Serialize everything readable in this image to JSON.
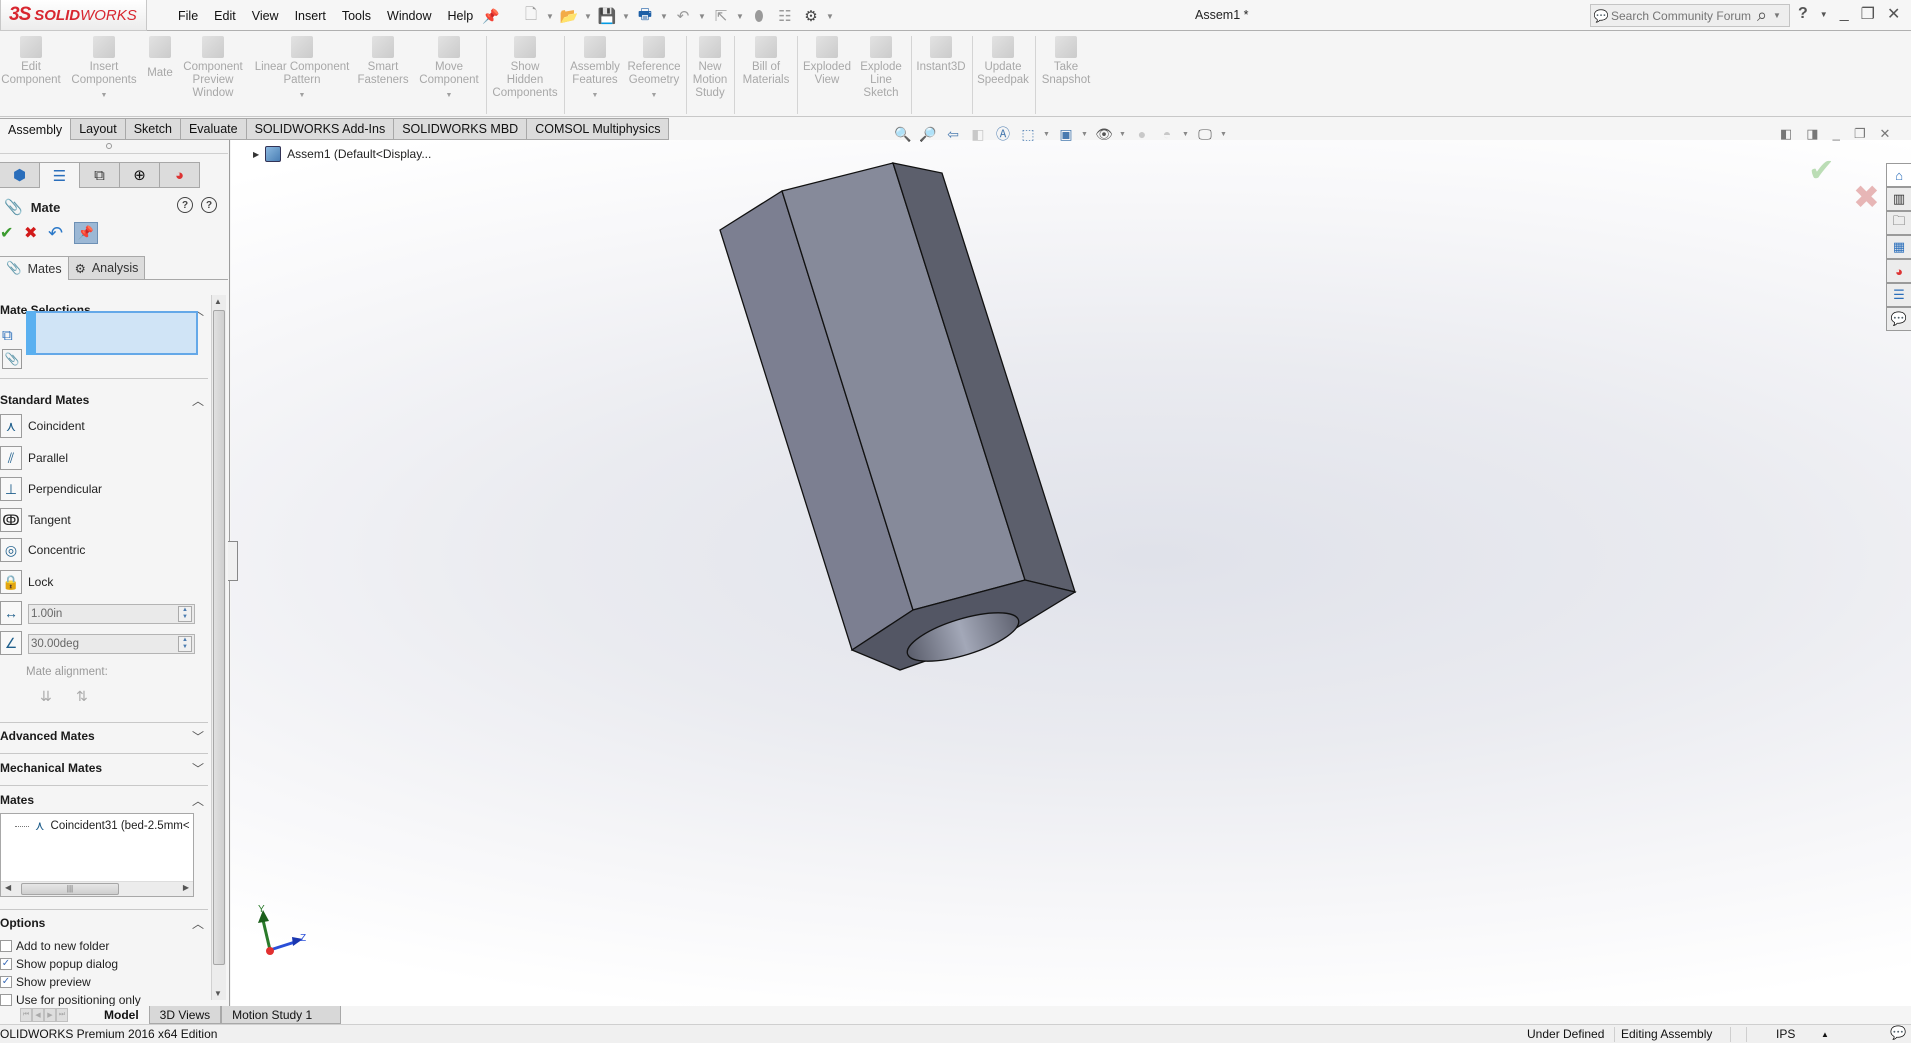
{
  "app": {
    "logo_mark": "3S",
    "logo_bold": "SOLID",
    "logo_light": "WORKS",
    "document_title": "Assem1 *"
  },
  "menubar": {
    "items": [
      "File",
      "Edit",
      "View",
      "Insert",
      "Tools",
      "Window",
      "Help"
    ]
  },
  "quick_access": {
    "icons": [
      "new-document-icon",
      "open-icon",
      "save-icon",
      "print-icon",
      "undo-icon",
      "select-icon",
      "rebuild-icon",
      "file-properties-icon",
      "options-gear-icon"
    ]
  },
  "search": {
    "placeholder": "Search Community Forum"
  },
  "window_controls": {
    "help": "?",
    "minimize": "_",
    "restore": "❐",
    "close": "✕"
  },
  "command_manager": {
    "commands": [
      {
        "label1": "Edit",
        "label2": "Component",
        "label3": "",
        "dropdown": false
      },
      {
        "label1": "Insert",
        "label2": "Components",
        "label3": "",
        "dropdown": true
      },
      {
        "label1": "Mate",
        "label2": "",
        "label3": "",
        "dropdown": false
      },
      {
        "label1": "Component",
        "label2": "Preview",
        "label3": "Window",
        "dropdown": false
      },
      {
        "label1": "Linear Component",
        "label2": "Pattern",
        "label3": "",
        "dropdown": true
      },
      {
        "label1": "Smart",
        "label2": "Fasteners",
        "label3": "",
        "dropdown": false
      },
      {
        "label1": "Move",
        "label2": "Component",
        "label3": "",
        "dropdown": true
      },
      {
        "label1": "Show",
        "label2": "Hidden",
        "label3": "Components",
        "dropdown": false
      },
      {
        "label1": "Assembly",
        "label2": "Features",
        "label3": "",
        "dropdown": true
      },
      {
        "label1": "Reference",
        "label2": "Geometry",
        "label3": "",
        "dropdown": true
      },
      {
        "label1": "New",
        "label2": "Motion",
        "label3": "Study",
        "dropdown": false
      },
      {
        "label1": "Bill of",
        "label2": "Materials",
        "label3": "",
        "dropdown": false
      },
      {
        "label1": "Exploded",
        "label2": "View",
        "label3": "",
        "dropdown": false
      },
      {
        "label1": "Explode",
        "label2": "Line",
        "label3": "Sketch",
        "dropdown": false
      },
      {
        "label1": "Instant3D",
        "label2": "",
        "label3": "",
        "dropdown": false
      },
      {
        "label1": "Update",
        "label2": "Speedpak",
        "label3": "",
        "dropdown": false
      },
      {
        "label1": "Take",
        "label2": "Snapshot",
        "label3": "",
        "dropdown": false
      }
    ]
  },
  "tabs": [
    {
      "label": "Assembly",
      "active": true
    },
    {
      "label": "Layout",
      "active": false
    },
    {
      "label": "Sketch",
      "active": false
    },
    {
      "label": "Evaluate",
      "active": false
    },
    {
      "label": "SOLIDWORKS Add-Ins",
      "active": false
    },
    {
      "label": "SOLIDWORKS MBD",
      "active": false
    },
    {
      "label": "COMSOL Multiphysics",
      "active": false
    }
  ],
  "feature_tree": {
    "root_label": "Assem1  (Default<Display..."
  },
  "property_manager": {
    "title": "Mate",
    "subtabs": [
      {
        "label": "Mates",
        "active": true
      },
      {
        "label": "Analysis",
        "active": false
      }
    ],
    "mate_selections": {
      "header": "Mate Selections"
    },
    "standard_mates": {
      "header": "Standard Mates",
      "items": [
        "Coincident",
        "Parallel",
        "Perpendicular",
        "Tangent",
        "Concentric",
        "Lock"
      ],
      "distance_value": "1.00in",
      "angle_value": "30.00deg",
      "alignment_label": "Mate alignment:"
    },
    "advanced_mates": {
      "header": "Advanced Mates"
    },
    "mechanical_mates": {
      "header": "Mechanical Mates"
    },
    "mates": {
      "header": "Mates",
      "items": [
        "Coincident31 (bed-2.5mm<"
      ]
    },
    "options": {
      "header": "Options",
      "checkboxes": [
        {
          "label": "Add to new folder",
          "checked": false
        },
        {
          "label": "Show popup dialog",
          "checked": true
        },
        {
          "label": "Show preview",
          "checked": true
        },
        {
          "label": "Use for positioning only",
          "checked": false
        }
      ]
    }
  },
  "bottom_tabs": [
    {
      "label": "Model",
      "active": true
    },
    {
      "label": "3D Views",
      "active": false
    },
    {
      "label": "Motion Study 1",
      "active": false
    }
  ],
  "status_bar": {
    "product": "OLIDWORKS Premium 2016 x64 Edition",
    "definition": "Under Defined",
    "mode": "Editing Assembly",
    "units": "IPS"
  },
  "triad": {
    "y": "Y",
    "z": "Z"
  },
  "colors": {
    "brand_red": "#d8262f",
    "selection_blue": "#d0e4f6",
    "model_face_light": "#868a9a",
    "model_face_mid": "#7c7f91",
    "model_face_dark": "#5c5f6c"
  }
}
